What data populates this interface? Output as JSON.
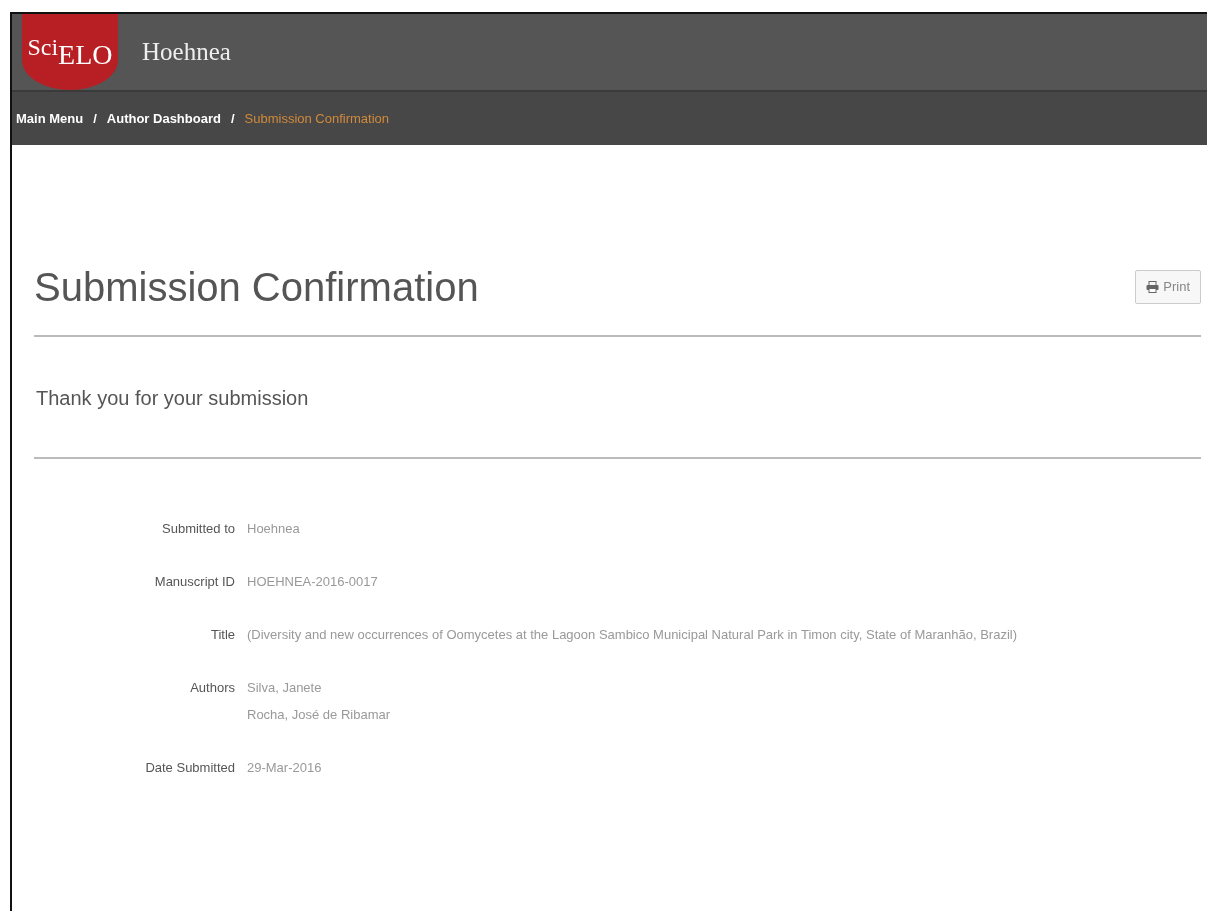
{
  "header": {
    "logo": [
      "Sci",
      "ELO"
    ],
    "journal": "Hoehnea"
  },
  "breadcrumb": [
    {
      "label": "Main Menu",
      "current": false
    },
    {
      "label": "Author Dashboard",
      "current": false
    },
    {
      "label": "Submission Confirmation",
      "current": true
    }
  ],
  "breadcrumb_separators": [
    "/",
    "/"
  ],
  "page_title": "Submission Confirmation",
  "print_button": "Print",
  "subtitle": "Thank you for your submission",
  "details": [
    {
      "label": "Submitted to",
      "values": [
        "Hoehnea"
      ]
    },
    {
      "label": "Manuscript ID",
      "values": [
        "HOEHNEA-2016-0017"
      ]
    },
    {
      "label": "Title",
      "values": [
        "(Diversity and new occurrences of Oomycetes at the Lagoon Sambico Municipal Natural Park in Timon city, State of Maranhão, Brazil)"
      ]
    },
    {
      "label": "Authors",
      "values": [
        "Silva, Janete",
        "Rocha, José de Ribamar"
      ]
    },
    {
      "label": "Date Submitted",
      "values": [
        "29-Mar-2016"
      ]
    }
  ]
}
